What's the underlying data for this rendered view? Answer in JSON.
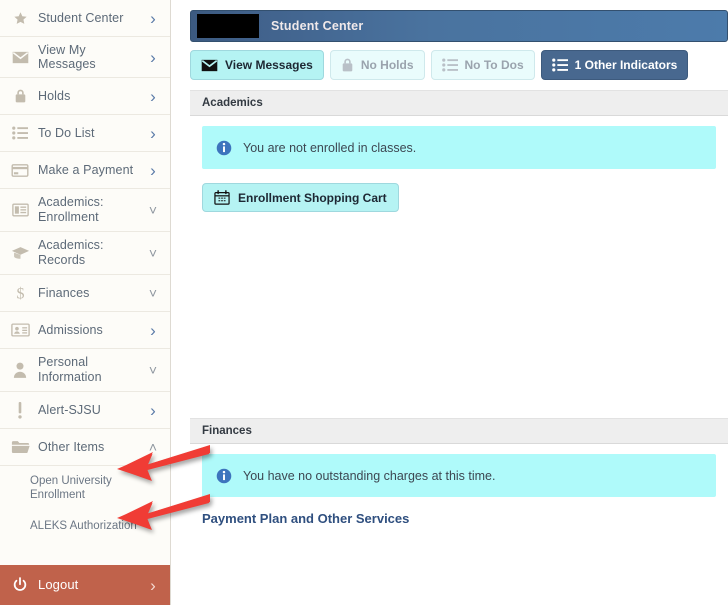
{
  "sidebar": {
    "items": [
      {
        "label": "Student Center",
        "icon": "star-icon",
        "chevron": "right",
        "two_line": false
      },
      {
        "label": "View My Messages",
        "icon": "envelope-icon",
        "chevron": "right",
        "two_line": false
      },
      {
        "label": "Holds",
        "icon": "lock-icon",
        "chevron": "right",
        "two_line": false
      },
      {
        "label": "To Do List",
        "icon": "list-icon",
        "chevron": "right",
        "two_line": false
      },
      {
        "label": "Make a Payment",
        "icon": "credit-card-icon",
        "chevron": "right",
        "two_line": false
      },
      {
        "label": "Academics: Enrollment",
        "icon": "form-icon",
        "chevron": "down",
        "two_line": true
      },
      {
        "label": "Academics: Records",
        "icon": "graduation-cap-icon",
        "chevron": "down",
        "two_line": true
      },
      {
        "label": "Finances",
        "icon": "dollar-icon",
        "chevron": "down",
        "two_line": false
      },
      {
        "label": "Admissions",
        "icon": "id-card-icon",
        "chevron": "right",
        "two_line": false
      },
      {
        "label": "Personal Information",
        "icon": "person-icon",
        "chevron": "down",
        "two_line": true
      },
      {
        "label": "Alert-SJSU",
        "icon": "exclamation-icon",
        "chevron": "right",
        "two_line": false
      },
      {
        "label": "Other Items",
        "icon": "folder-icon",
        "chevron": "up",
        "two_line": false
      }
    ],
    "sub_items": [
      {
        "label": "Open University Enrollment"
      },
      {
        "label": "ALEKS Authorization"
      }
    ],
    "logout": {
      "label": "Logout",
      "icon": "power-icon",
      "chevron": "right"
    }
  },
  "header": {
    "title": "Student Center",
    "redacted": true
  },
  "tabs": [
    {
      "label": "View Messages",
      "icon": "envelope-icon",
      "state": "active-light"
    },
    {
      "label": "No Holds",
      "icon": "lock-icon",
      "state": "disabled"
    },
    {
      "label": "No To Dos",
      "icon": "list-icon",
      "state": "disabled"
    },
    {
      "label": "1 Other Indicators",
      "icon": "list-icon",
      "state": "dark"
    }
  ],
  "academics": {
    "section_title": "Academics",
    "info_message": "You are not enrolled in classes.",
    "info_icon": "info-icon",
    "cart_button": {
      "label": "Enrollment Shopping Cart",
      "icon": "calendar-icon"
    }
  },
  "finances": {
    "section_title": "Finances",
    "info_message": "You have no outstanding charges at this time.",
    "info_icon": "info-icon",
    "link": "Payment Plan and Other Services"
  },
  "annotations": {
    "arrow_color": "#f03c35",
    "arrows": [
      {
        "name": "arrow-other-items"
      },
      {
        "name": "arrow-open-university-enrollment"
      }
    ]
  }
}
